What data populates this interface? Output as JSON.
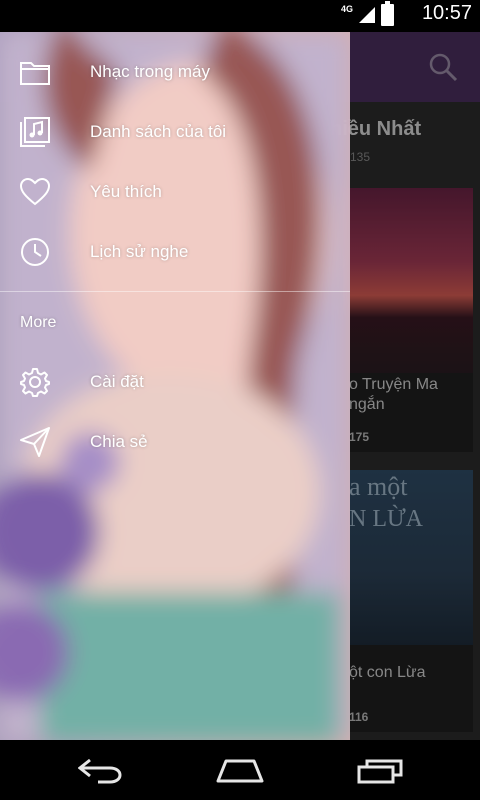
{
  "status_bar": {
    "time": "10:57",
    "network": "4G",
    "icons": [
      "signal-icon",
      "battery-icon"
    ]
  },
  "background_app": {
    "section_title": "hiều Nhất",
    "section_sub": "135",
    "cards": [
      {
        "title_line1": "o Truyện Ma",
        "title_line2": "ngắn",
        "count": "175"
      },
      {
        "title_line1": "ột con Lừa",
        "count": "116",
        "cover_text": "a một",
        "cover_text2": "N LỪA"
      }
    ]
  },
  "drawer": {
    "items": [
      {
        "label": "Nhạc trong máy",
        "icon": "folder-icon"
      },
      {
        "label": "Danh sách của tôi",
        "icon": "playlist-icon"
      },
      {
        "label": "Yêu thích",
        "icon": "heart-icon"
      },
      {
        "label": "Lịch sử nghe",
        "icon": "clock-icon"
      }
    ],
    "more_label": "More",
    "more_items": [
      {
        "label": "Cài đặt",
        "icon": "gear-icon"
      },
      {
        "label": "Chia sẻ",
        "icon": "share-icon"
      }
    ]
  },
  "navbar": {
    "buttons": [
      "back-icon",
      "home-icon",
      "recents-icon"
    ]
  },
  "colors": {
    "toolbar": "#4a2f5e",
    "statusbar": "#000000",
    "drawer_text": "#ffffff"
  }
}
